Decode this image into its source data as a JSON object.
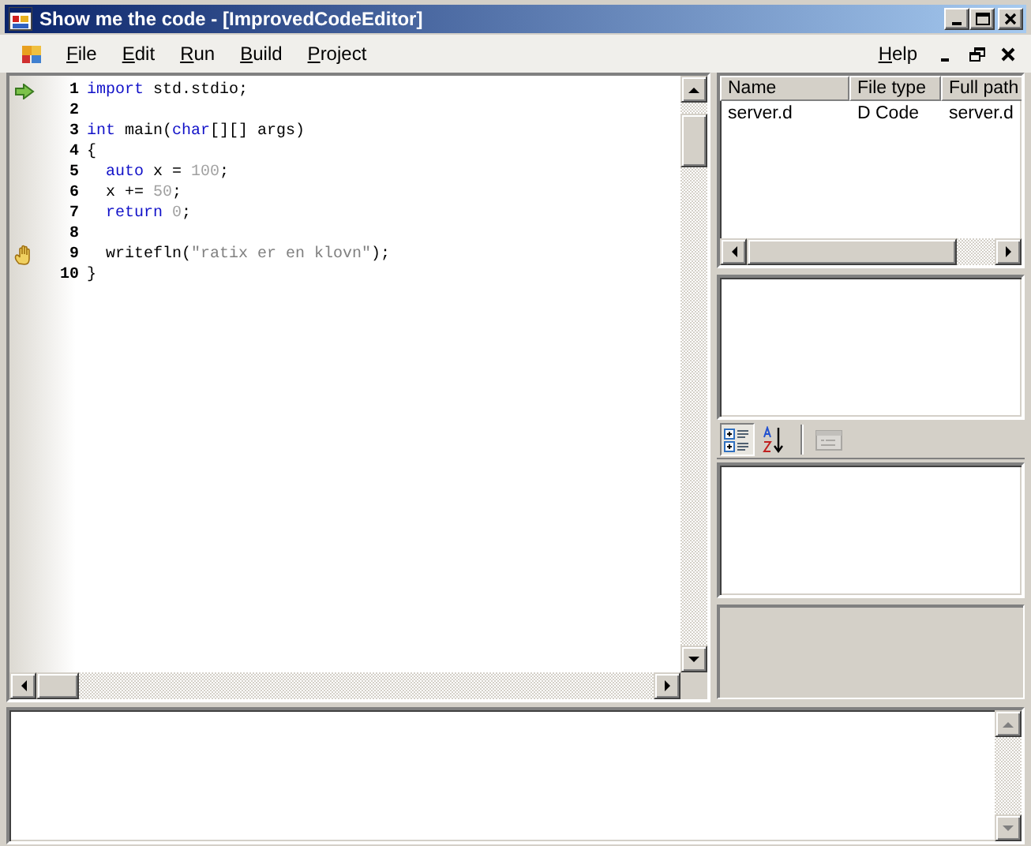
{
  "window": {
    "title": "Show me the code - [ImprovedCodeEditor]"
  },
  "menu": [
    {
      "label": "File"
    },
    {
      "label": "Edit"
    },
    {
      "label": "Run"
    },
    {
      "label": "Build"
    },
    {
      "label": "Project"
    }
  ],
  "help": {
    "label": "Help"
  },
  "editor": {
    "lines": [
      {
        "number": "1",
        "current": true,
        "breakpoint": false,
        "tokens": [
          {
            "text": "import",
            "kind": "keyword"
          },
          {
            "text": " std.stdio;",
            "kind": "plain"
          }
        ]
      },
      {
        "number": "2",
        "current": false,
        "breakpoint": false
      },
      {
        "number": "3",
        "current": false,
        "breakpoint": false,
        "tokens": [
          {
            "text": "int",
            "kind": "keyword"
          },
          {
            "text": " main(",
            "kind": "plain"
          },
          {
            "text": "char",
            "kind": "keyword"
          },
          {
            "text": "[][] args)",
            "kind": "plain"
          }
        ]
      },
      {
        "number": "4",
        "current": false,
        "breakpoint": false,
        "tokens": [
          {
            "text": "{",
            "kind": "plain"
          }
        ]
      },
      {
        "number": "5",
        "current": false,
        "breakpoint": false,
        "tokens": [
          {
            "text": "  auto",
            "kind": "keyword"
          },
          {
            "text": " x = ",
            "kind": "plain"
          },
          {
            "text": "100",
            "kind": "number"
          },
          {
            "text": ";",
            "kind": "plain"
          }
        ]
      },
      {
        "number": "6",
        "current": false,
        "breakpoint": false,
        "tokens": [
          {
            "text": "  x += ",
            "kind": "plain"
          },
          {
            "text": "50",
            "kind": "number"
          },
          {
            "text": ";",
            "kind": "plain"
          }
        ]
      },
      {
        "number": "7",
        "current": false,
        "breakpoint": false,
        "tokens": [
          {
            "text": "  return ",
            "kind": "keyword"
          },
          {
            "text": "0",
            "kind": "number"
          },
          {
            "text": ";",
            "kind": "plain"
          }
        ]
      },
      {
        "number": "8",
        "current": false,
        "breakpoint": false
      },
      {
        "number": "9",
        "current": false,
        "breakpoint": true,
        "tokens": [
          {
            "text": "  writefln(",
            "kind": "plain"
          },
          {
            "text": "\"ratix er en klovn\"",
            "kind": "string"
          },
          {
            "text": ");",
            "kind": "plain"
          }
        ]
      },
      {
        "number": "10",
        "current": false,
        "breakpoint": false,
        "tokens": [
          {
            "text": "}",
            "kind": "plain"
          }
        ]
      }
    ]
  },
  "files": {
    "columns": [
      "Name",
      "File type",
      "Full path"
    ],
    "rows": [
      {
        "cells": [
          "server.d",
          "D Code",
          "server.d"
        ],
        "selected": false
      }
    ]
  },
  "properties": {
    "tools": [
      {
        "kind": "categorized",
        "selected": true,
        "disabled": false
      },
      {
        "kind": "alphabetical",
        "selected": false,
        "disabled": false
      },
      {
        "kind": "pages",
        "selected": false,
        "disabled": true
      }
    ]
  }
}
